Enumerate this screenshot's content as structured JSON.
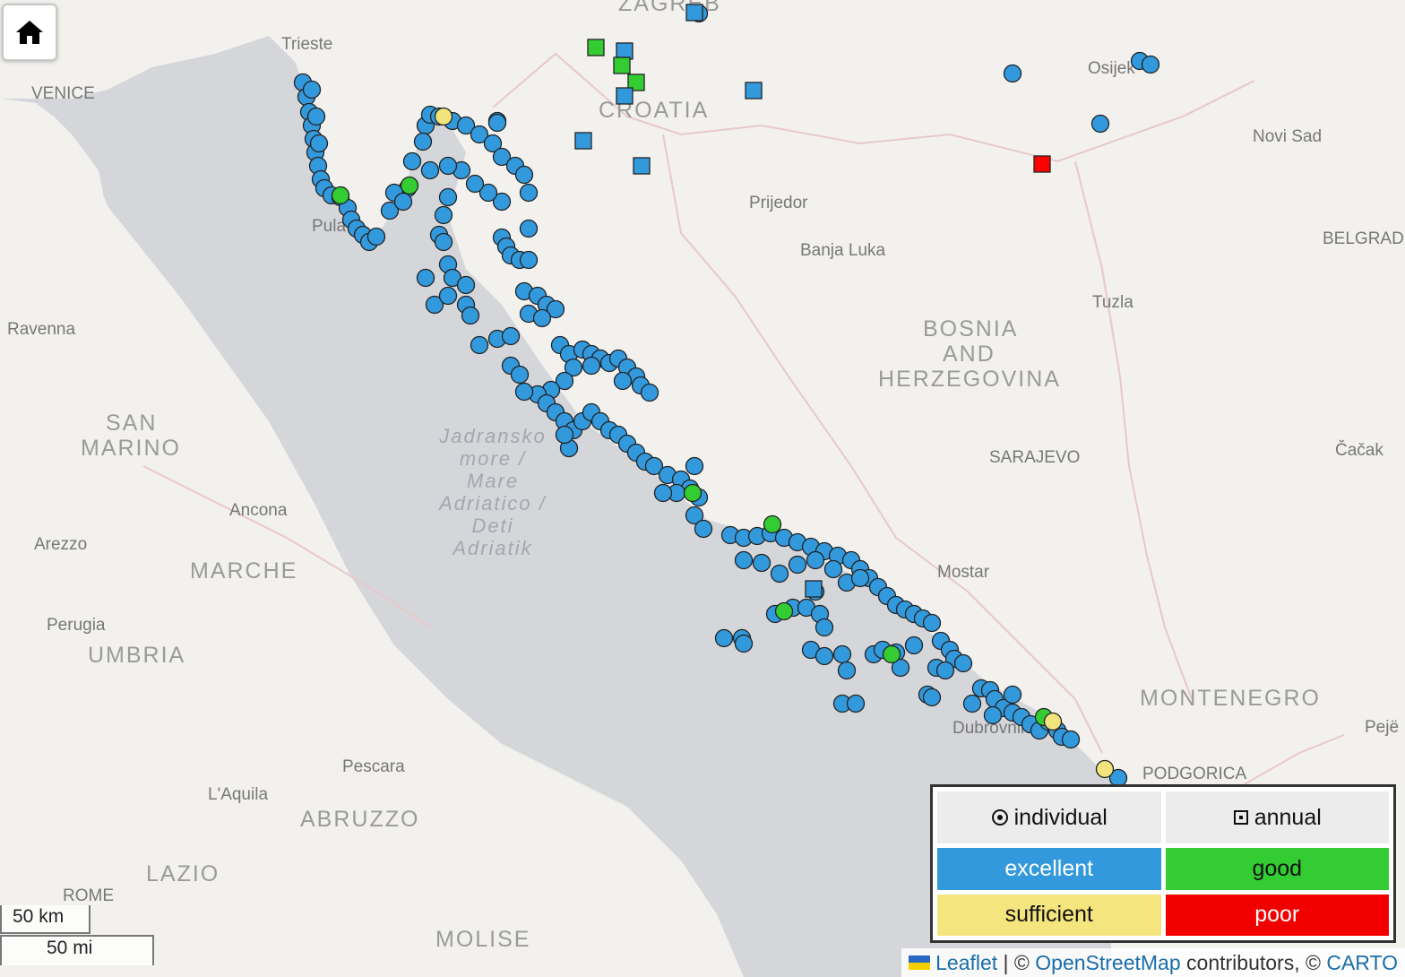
{
  "home_button": {
    "icon": "home-icon"
  },
  "cities": [
    {
      "name": "ZAGREB",
      "kind": "country"
    },
    {
      "name": "Trieste",
      "kind": "city"
    },
    {
      "name": "VENICE",
      "kind": "city"
    },
    {
      "name": "Osijek",
      "kind": "city"
    },
    {
      "name": "CROATIA",
      "kind": "country"
    },
    {
      "name": "Novi Sad",
      "kind": "city"
    },
    {
      "name": "Prijedor",
      "kind": "city"
    },
    {
      "name": "Banja Luka",
      "kind": "city"
    },
    {
      "name": "BELGRADE",
      "kind": "city"
    },
    {
      "name": "Pula",
      "kind": "city"
    },
    {
      "name": "Ravenna",
      "kind": "city"
    },
    {
      "name": "Tuzla",
      "kind": "city"
    },
    {
      "name": "BOSNIA",
      "kind": "country"
    },
    {
      "name": "AND",
      "kind": "country"
    },
    {
      "name": "HERZEGOVINA",
      "kind": "country"
    },
    {
      "name": "SAN",
      "kind": "country"
    },
    {
      "name": "MARINO",
      "kind": "country"
    },
    {
      "name": "SARAJEVO",
      "kind": "city"
    },
    {
      "name": "Čačak",
      "kind": "city"
    },
    {
      "name": "Ancona",
      "kind": "city"
    },
    {
      "name": "Arezzo",
      "kind": "city"
    },
    {
      "name": "MARCHE",
      "kind": "country"
    },
    {
      "name": "Mostar",
      "kind": "city"
    },
    {
      "name": "Perugia",
      "kind": "city"
    },
    {
      "name": "UMBRIA",
      "kind": "country"
    },
    {
      "name": "MONTENEGRO",
      "kind": "country"
    },
    {
      "name": "Pejë",
      "kind": "city"
    },
    {
      "name": "Dubrovnik",
      "kind": "city"
    },
    {
      "name": "PODGORICA",
      "kind": "city"
    },
    {
      "name": "Pescara",
      "kind": "city"
    },
    {
      "name": "L'Aquila",
      "kind": "city"
    },
    {
      "name": "ABRUZZO",
      "kind": "country"
    },
    {
      "name": "LAZIO",
      "kind": "country"
    },
    {
      "name": "ROME",
      "kind": "city"
    },
    {
      "name": "MOLISE",
      "kind": "country"
    }
  ],
  "sea_label": [
    "Jadransko",
    "more /",
    "Mare",
    "Adriatico /",
    "Deti",
    "Adriatik"
  ],
  "legend": {
    "individual": "individual",
    "annual": "annual",
    "excellent": "excellent",
    "good": "good",
    "sufficient": "sufficient",
    "poor": "poor"
  },
  "colors": {
    "excellent": "#3399dd",
    "good": "#33cc33",
    "sufficient": "#f2e47c",
    "poor": "#ff0000",
    "sea": "#d4d6da",
    "land": "#f2f1ee"
  },
  "scale": {
    "km": "50 km",
    "mi": "50 mi"
  },
  "attribution": {
    "leaflet": "Leaflet",
    "sep1": " | © ",
    "osm": "OpenStreetMap",
    "contrib": " contributors, © ",
    "carto": "CARTO"
  }
}
